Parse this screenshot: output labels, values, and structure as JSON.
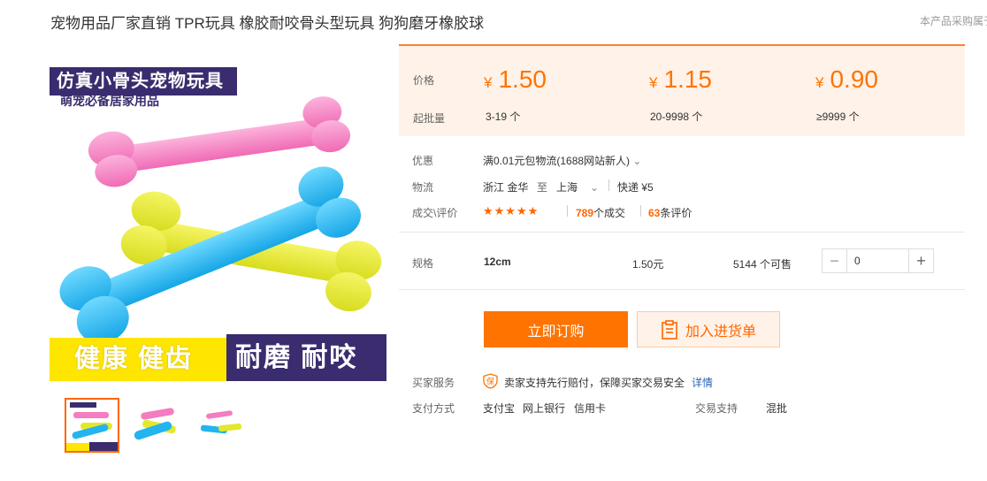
{
  "title": "宠物用品厂家直销 TPR玩具 橡胶耐咬骨头型玩具 狗狗磨牙橡胶球",
  "notice": "本产品采购属于",
  "image": {
    "banner_top": "仿真小骨头宠物玩具",
    "banner_sub": "萌宠必备居家用品",
    "bottom_left": "健康 健齿",
    "bottom_right": "耐磨 耐咬"
  },
  "price_table": {
    "price_label": "价格",
    "moq_label": "起批量",
    "currency": "¥",
    "tiers": [
      {
        "price": "1.50",
        "qty": "3-19 个"
      },
      {
        "price": "1.15",
        "qty": "20-9998 个"
      },
      {
        "price": "0.90",
        "qty": "≥9999 个"
      }
    ]
  },
  "promo": {
    "label": "优惠",
    "text": "满0.01元包物流(1688网站新人)"
  },
  "logistics": {
    "label": "物流",
    "from": "浙江 金华",
    "to_word": "至",
    "to": "上海",
    "express": "快递 ¥5"
  },
  "deals": {
    "label": "成交\\评价",
    "stars": "★★★★★",
    "deals_count": "789",
    "deals_word": "个成交",
    "reviews_count": "63",
    "reviews_word": "条评价"
  },
  "spec": {
    "label": "规格",
    "name": "12cm",
    "price": "1.50元",
    "stock": "5144 个可售",
    "quantity": "0"
  },
  "buttons": {
    "buy": "立即订购",
    "cart": "加入进货单"
  },
  "service": {
    "label": "买家服务",
    "badge": "保",
    "text": "卖家支持先行赔付，保障买家交易安全",
    "detail": "详情"
  },
  "payment": {
    "label": "支付方式",
    "methods": [
      "支付宝",
      "网上银行",
      "信用卡"
    ],
    "trade_label": "交易支持",
    "trade_value": "混批"
  },
  "colors": {
    "accent": "#ff7300",
    "price_bg": "#fff2e8",
    "banner": "#3a2c6e",
    "yellow": "#ffe600",
    "pink": "#f97ec0",
    "blue": "#22b6f0",
    "lime": "#e9ec2c"
  }
}
